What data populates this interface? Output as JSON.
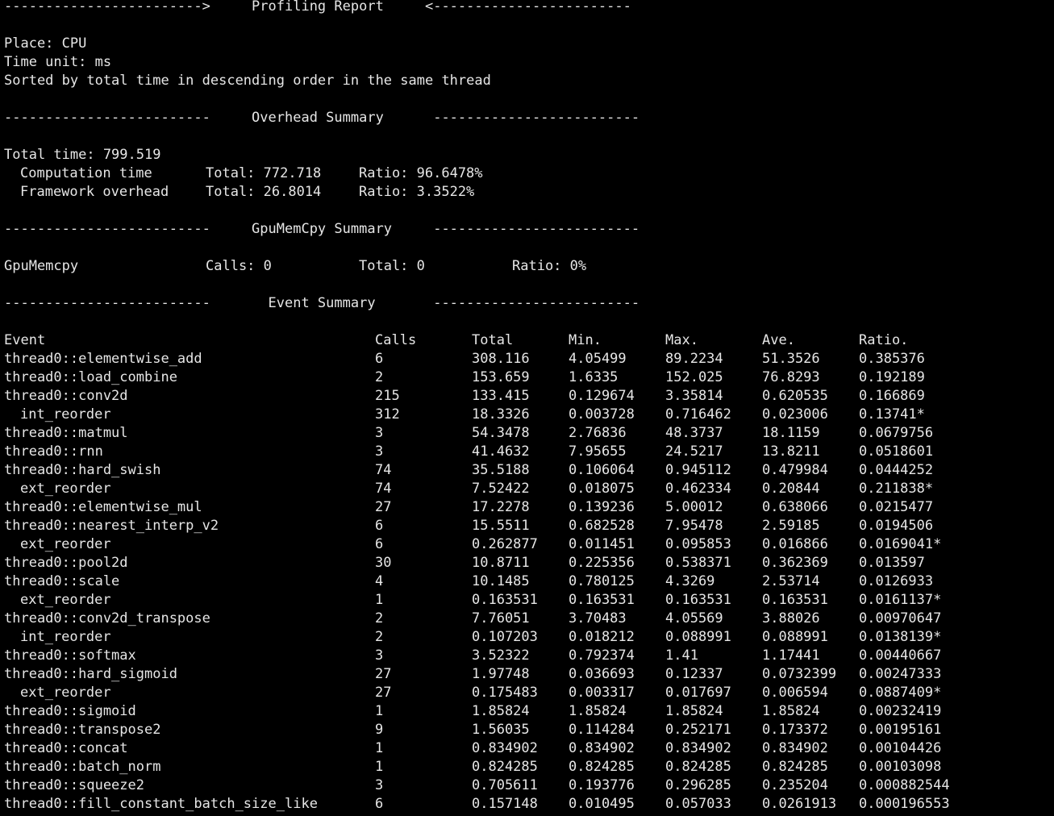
{
  "report": {
    "title_line": "------------------------>     Profiling Report     <------------------------",
    "place": "Place: CPU",
    "time_unit": "Time unit: ms",
    "sorted": "Sorted by total time in descending order in the same thread"
  },
  "overhead": {
    "divider": "-------------------------     Overhead Summary      -------------------------",
    "total_time": "Total time: 799.519",
    "computation": {
      "label": "Computation time",
      "total": "Total: 772.718",
      "ratio": "Ratio: 96.6478%"
    },
    "framework": {
      "label": "Framework overhead",
      "total": "Total: 26.8014",
      "ratio": "Ratio: 3.3522%"
    }
  },
  "gpumemcpy": {
    "divider": "-------------------------     GpuMemCpy Summary     -------------------------",
    "name": "GpuMemcpy",
    "calls": "Calls: 0",
    "total": "Total: 0",
    "ratio": "Ratio: 0%"
  },
  "events": {
    "divider": "-------------------------       Event Summary       -------------------------",
    "headers": [
      "Event",
      "Calls",
      "Total",
      "Min.",
      "Max.",
      "Ave.",
      "Ratio."
    ],
    "rows": [
      [
        "thread0::elementwise_add",
        "6",
        "308.116",
        "4.05499",
        "89.2234",
        "51.3526",
        "0.385376"
      ],
      [
        "thread0::load_combine",
        "2",
        "153.659",
        "1.6335",
        "152.025",
        "76.8293",
        "0.192189"
      ],
      [
        "thread0::conv2d",
        "215",
        "133.415",
        "0.129674",
        "3.35814",
        "0.620535",
        "0.166869"
      ],
      [
        "int_reorder",
        "312",
        "18.3326",
        "0.003728",
        "0.716462",
        "0.023006",
        "0.13741*"
      ],
      [
        "thread0::matmul",
        "3",
        "54.3478",
        "2.76836",
        "48.3737",
        "18.1159",
        "0.0679756"
      ],
      [
        "thread0::rnn",
        "3",
        "41.4632",
        "7.95655",
        "24.5217",
        "13.8211",
        "0.0518601"
      ],
      [
        "thread0::hard_swish",
        "74",
        "35.5188",
        "0.106064",
        "0.945112",
        "0.479984",
        "0.0444252"
      ],
      [
        "ext_reorder",
        "74",
        "7.52422",
        "0.018075",
        "0.462334",
        "0.20844",
        "0.211838*"
      ],
      [
        "thread0::elementwise_mul",
        "27",
        "17.2278",
        "0.139236",
        "5.00012",
        "0.638066",
        "0.0215477"
      ],
      [
        "thread0::nearest_interp_v2",
        "6",
        "15.5511",
        "0.682528",
        "7.95478",
        "2.59185",
        "0.0194506"
      ],
      [
        "ext_reorder",
        "6",
        "0.262877",
        "0.011451",
        "0.095853",
        "0.016866",
        "0.0169041*"
      ],
      [
        "thread0::pool2d",
        "30",
        "10.8711",
        "0.225356",
        "0.538371",
        "0.362369",
        "0.013597"
      ],
      [
        "thread0::scale",
        "4",
        "10.1485",
        "0.780125",
        "4.3269",
        "2.53714",
        "0.0126933"
      ],
      [
        "ext_reorder",
        "1",
        "0.163531",
        "0.163531",
        "0.163531",
        "0.163531",
        "0.0161137*"
      ],
      [
        "thread0::conv2d_transpose",
        "2",
        "7.76051",
        "3.70483",
        "4.05569",
        "3.88026",
        "0.00970647"
      ],
      [
        "int_reorder",
        "2",
        "0.107203",
        "0.018212",
        "0.088991",
        "0.088991",
        "0.0138139*"
      ],
      [
        "thread0::softmax",
        "3",
        "3.52322",
        "0.792374",
        "1.41",
        "1.17441",
        "0.00440667"
      ],
      [
        "thread0::hard_sigmoid",
        "27",
        "1.97748",
        "0.036693",
        "0.12337",
        "0.0732399",
        "0.00247333"
      ],
      [
        "ext_reorder",
        "27",
        "0.175483",
        "0.003317",
        "0.017697",
        "0.006594",
        "0.0887409*"
      ],
      [
        "thread0::sigmoid",
        "1",
        "1.85824",
        "1.85824",
        "1.85824",
        "1.85824",
        "0.00232419"
      ],
      [
        "thread0::transpose2",
        "9",
        "1.56035",
        "0.114284",
        "0.252171",
        "0.173372",
        "0.00195161"
      ],
      [
        "thread0::concat",
        "1",
        "0.834902",
        "0.834902",
        "0.834902",
        "0.834902",
        "0.00104426"
      ],
      [
        "thread0::batch_norm",
        "1",
        "0.824285",
        "0.824285",
        "0.824285",
        "0.824285",
        "0.00103098"
      ],
      [
        "thread0::squeeze2",
        "3",
        "0.705611",
        "0.193776",
        "0.296285",
        "0.235204",
        "0.000882544"
      ],
      [
        "thread0::fill_constant_batch_size_like",
        "6",
        "0.157148",
        "0.010495",
        "0.057033",
        "0.0261913",
        "0.000196553"
      ]
    ],
    "indented": [
      false,
      false,
      false,
      true,
      false,
      false,
      false,
      true,
      false,
      false,
      true,
      false,
      false,
      true,
      false,
      true,
      false,
      false,
      true,
      false,
      false,
      false,
      false,
      false,
      false
    ]
  },
  "colors": {
    "background": "#000000",
    "text": "#e6e6e6"
  }
}
